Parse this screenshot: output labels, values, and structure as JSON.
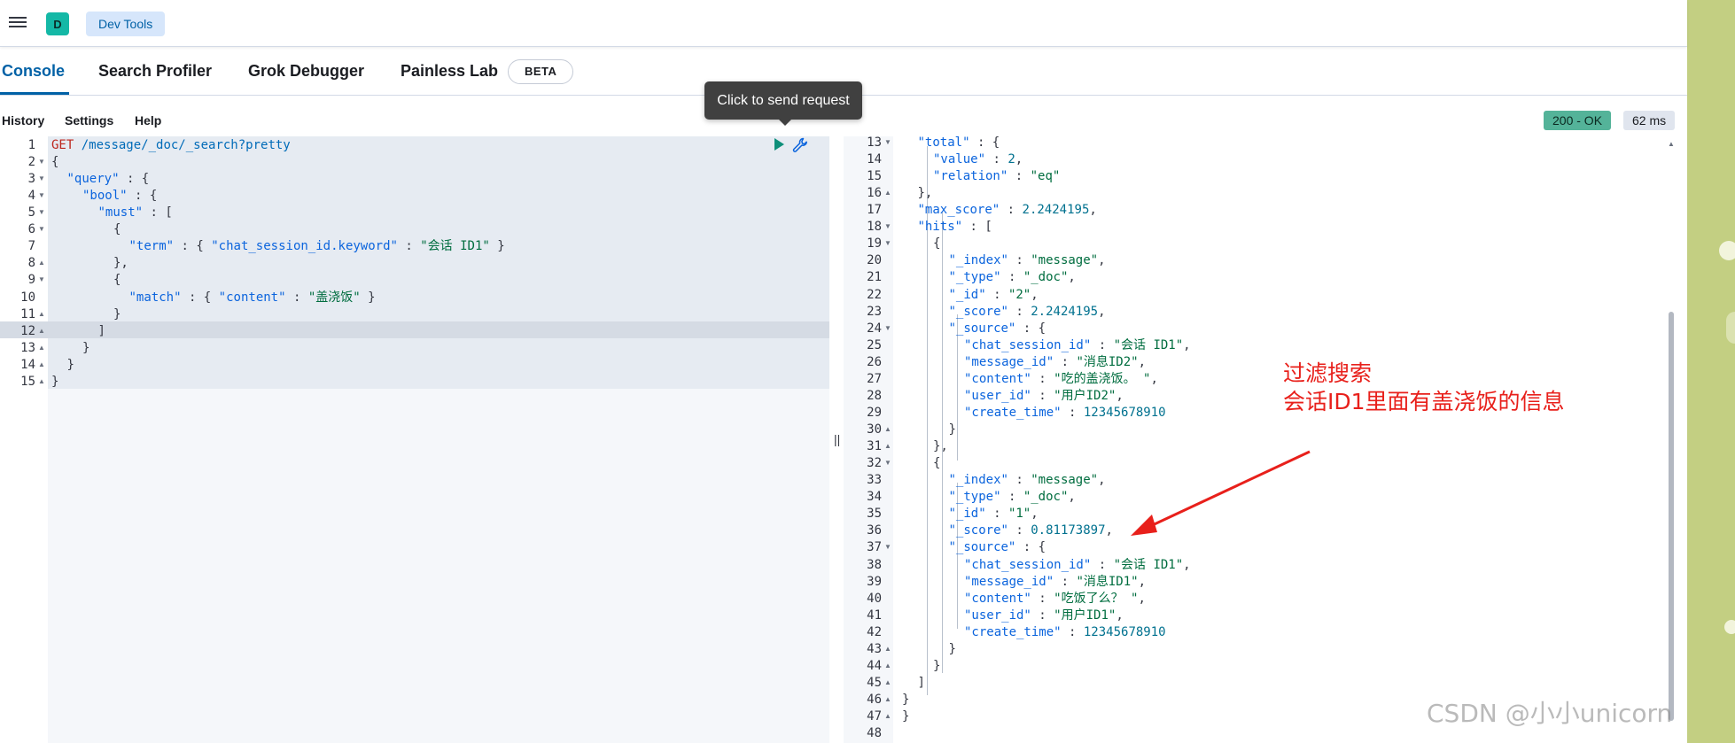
{
  "header": {
    "space_initial": "D",
    "breadcrumb": "Dev Tools"
  },
  "tabs": [
    {
      "label": "Console",
      "active": true
    },
    {
      "label": "Search Profiler",
      "active": false
    },
    {
      "label": "Grok Debugger",
      "active": false
    },
    {
      "label": "Painless Lab",
      "active": false
    }
  ],
  "beta_badge": "BETA",
  "tooltip": "Click to send request",
  "toolbar": {
    "history": "History",
    "settings": "Settings",
    "help": "Help"
  },
  "status": {
    "code": "200 - OK",
    "time": "62 ms"
  },
  "colors": {
    "accent": "#0061a6",
    "ok_badge": "#54b399",
    "annotation": "#e8201b"
  },
  "icons": [
    "menu-icon",
    "play-icon",
    "wrench-icon"
  ],
  "request": {
    "lines": [
      {
        "n": "1",
        "fold": "",
        "indent": 0,
        "tokens": [
          [
            "m",
            "GET"
          ],
          [
            "p",
            " "
          ],
          [
            "u",
            "/message/_doc/_search?pretty"
          ]
        ]
      },
      {
        "n": "2",
        "fold": "down",
        "indent": 0,
        "tokens": [
          [
            "p",
            "{"
          ]
        ]
      },
      {
        "n": "3",
        "fold": "down",
        "indent": 1,
        "tokens": [
          [
            "k",
            "\"query\""
          ],
          [
            "p",
            " : {"
          ]
        ]
      },
      {
        "n": "4",
        "fold": "down",
        "indent": 2,
        "tokens": [
          [
            "k",
            "\"bool\""
          ],
          [
            "p",
            " : {"
          ]
        ]
      },
      {
        "n": "5",
        "fold": "down",
        "indent": 3,
        "tokens": [
          [
            "k",
            "\"must\""
          ],
          [
            "p",
            " : ["
          ]
        ]
      },
      {
        "n": "6",
        "fold": "down",
        "indent": 4,
        "tokens": [
          [
            "p",
            "{"
          ]
        ]
      },
      {
        "n": "7",
        "fold": "",
        "indent": 5,
        "tokens": [
          [
            "k",
            "\"term\""
          ],
          [
            "p",
            " : { "
          ],
          [
            "k",
            "\"chat_session_id.keyword\""
          ],
          [
            "p",
            " : "
          ],
          [
            "s",
            "\"会话 ID1\""
          ],
          [
            "p",
            " }"
          ]
        ]
      },
      {
        "n": "8",
        "fold": "up",
        "indent": 4,
        "tokens": [
          [
            "p",
            "},"
          ]
        ]
      },
      {
        "n": "9",
        "fold": "down",
        "indent": 4,
        "tokens": [
          [
            "p",
            "{"
          ]
        ]
      },
      {
        "n": "10",
        "fold": "",
        "indent": 5,
        "tokens": [
          [
            "k",
            "\"match\""
          ],
          [
            "p",
            " : { "
          ],
          [
            "k",
            "\"content\""
          ],
          [
            "p",
            " : "
          ],
          [
            "s",
            "\"盖浇饭\""
          ],
          [
            "p",
            " }"
          ]
        ]
      },
      {
        "n": "11",
        "fold": "up",
        "indent": 4,
        "tokens": [
          [
            "p",
            "}"
          ]
        ]
      },
      {
        "n": "12",
        "fold": "up",
        "indent": 3,
        "tokens": [
          [
            "p",
            "]"
          ]
        ]
      },
      {
        "n": "13",
        "fold": "up",
        "indent": 2,
        "tokens": [
          [
            "p",
            "}"
          ]
        ]
      },
      {
        "n": "14",
        "fold": "up",
        "indent": 1,
        "tokens": [
          [
            "p",
            "}"
          ]
        ]
      },
      {
        "n": "15",
        "fold": "up",
        "indent": 0,
        "tokens": [
          [
            "p",
            "}"
          ]
        ]
      }
    ]
  },
  "response": {
    "lines": [
      {
        "n": "13",
        "fold": "down",
        "indent": 1,
        "tokens": [
          [
            "k",
            "\"total\""
          ],
          [
            "p",
            " : {"
          ]
        ]
      },
      {
        "n": "14",
        "fold": "",
        "indent": 2,
        "tokens": [
          [
            "k",
            "\"value\""
          ],
          [
            "p",
            " : "
          ],
          [
            "n",
            "2"
          ],
          [
            "p",
            ","
          ]
        ]
      },
      {
        "n": "15",
        "fold": "",
        "indent": 2,
        "tokens": [
          [
            "k",
            "\"relation\""
          ],
          [
            "p",
            " : "
          ],
          [
            "s",
            "\"eq\""
          ]
        ]
      },
      {
        "n": "16",
        "fold": "up",
        "indent": 1,
        "tokens": [
          [
            "p",
            "},"
          ]
        ]
      },
      {
        "n": "17",
        "fold": "",
        "indent": 1,
        "tokens": [
          [
            "k",
            "\"max_score\""
          ],
          [
            "p",
            " : "
          ],
          [
            "n",
            "2.2424195"
          ],
          [
            "p",
            ","
          ]
        ]
      },
      {
        "n": "18",
        "fold": "down",
        "indent": 1,
        "tokens": [
          [
            "k",
            "\"hits\""
          ],
          [
            "p",
            " : ["
          ]
        ]
      },
      {
        "n": "19",
        "fold": "down",
        "indent": 2,
        "tokens": [
          [
            "p",
            "{"
          ]
        ]
      },
      {
        "n": "20",
        "fold": "",
        "indent": 3,
        "tokens": [
          [
            "k",
            "\"_index\""
          ],
          [
            "p",
            " : "
          ],
          [
            "s",
            "\"message\""
          ],
          [
            "p",
            ","
          ]
        ]
      },
      {
        "n": "21",
        "fold": "",
        "indent": 3,
        "tokens": [
          [
            "k",
            "\"_type\""
          ],
          [
            "p",
            " : "
          ],
          [
            "s",
            "\"_doc\""
          ],
          [
            "p",
            ","
          ]
        ]
      },
      {
        "n": "22",
        "fold": "",
        "indent": 3,
        "tokens": [
          [
            "k",
            "\"_id\""
          ],
          [
            "p",
            " : "
          ],
          [
            "s",
            "\"2\""
          ],
          [
            "p",
            ","
          ]
        ]
      },
      {
        "n": "23",
        "fold": "",
        "indent": 3,
        "tokens": [
          [
            "k",
            "\"_score\""
          ],
          [
            "p",
            " : "
          ],
          [
            "n",
            "2.2424195"
          ],
          [
            "p",
            ","
          ]
        ]
      },
      {
        "n": "24",
        "fold": "down",
        "indent": 3,
        "tokens": [
          [
            "k",
            "\"_source\""
          ],
          [
            "p",
            " : {"
          ]
        ]
      },
      {
        "n": "25",
        "fold": "",
        "indent": 4,
        "tokens": [
          [
            "k",
            "\"chat_session_id\""
          ],
          [
            "p",
            " : "
          ],
          [
            "s",
            "\"会话 ID1\""
          ],
          [
            "p",
            ","
          ]
        ]
      },
      {
        "n": "26",
        "fold": "",
        "indent": 4,
        "tokens": [
          [
            "k",
            "\"message_id\""
          ],
          [
            "p",
            " : "
          ],
          [
            "s",
            "\"消息ID2\""
          ],
          [
            "p",
            ","
          ]
        ]
      },
      {
        "n": "27",
        "fold": "",
        "indent": 4,
        "tokens": [
          [
            "k",
            "\"content\""
          ],
          [
            "p",
            " : "
          ],
          [
            "s",
            "\"吃的盖浇饭。 \""
          ],
          [
            "p",
            ","
          ]
        ]
      },
      {
        "n": "28",
        "fold": "",
        "indent": 4,
        "tokens": [
          [
            "k",
            "\"user_id\""
          ],
          [
            "p",
            " : "
          ],
          [
            "s",
            "\"用户ID2\""
          ],
          [
            "p",
            ","
          ]
        ]
      },
      {
        "n": "29",
        "fold": "",
        "indent": 4,
        "tokens": [
          [
            "k",
            "\"create_time\""
          ],
          [
            "p",
            " : "
          ],
          [
            "n",
            "12345678910"
          ]
        ]
      },
      {
        "n": "30",
        "fold": "up",
        "indent": 3,
        "tokens": [
          [
            "p",
            "}"
          ]
        ]
      },
      {
        "n": "31",
        "fold": "up",
        "indent": 2,
        "tokens": [
          [
            "p",
            "},"
          ]
        ]
      },
      {
        "n": "32",
        "fold": "down",
        "indent": 2,
        "tokens": [
          [
            "p",
            "{"
          ]
        ]
      },
      {
        "n": "33",
        "fold": "",
        "indent": 3,
        "tokens": [
          [
            "k",
            "\"_index\""
          ],
          [
            "p",
            " : "
          ],
          [
            "s",
            "\"message\""
          ],
          [
            "p",
            ","
          ]
        ]
      },
      {
        "n": "34",
        "fold": "",
        "indent": 3,
        "tokens": [
          [
            "k",
            "\"_type\""
          ],
          [
            "p",
            " : "
          ],
          [
            "s",
            "\"_doc\""
          ],
          [
            "p",
            ","
          ]
        ]
      },
      {
        "n": "35",
        "fold": "",
        "indent": 3,
        "tokens": [
          [
            "k",
            "\"_id\""
          ],
          [
            "p",
            " : "
          ],
          [
            "s",
            "\"1\""
          ],
          [
            "p",
            ","
          ]
        ]
      },
      {
        "n": "36",
        "fold": "",
        "indent": 3,
        "tokens": [
          [
            "k",
            "\"_score\""
          ],
          [
            "p",
            " : "
          ],
          [
            "n",
            "0.81173897"
          ],
          [
            "p",
            ","
          ]
        ]
      },
      {
        "n": "37",
        "fold": "down",
        "indent": 3,
        "tokens": [
          [
            "k",
            "\"_source\""
          ],
          [
            "p",
            " : {"
          ]
        ]
      },
      {
        "n": "38",
        "fold": "",
        "indent": 4,
        "tokens": [
          [
            "k",
            "\"chat_session_id\""
          ],
          [
            "p",
            " : "
          ],
          [
            "s",
            "\"会话 ID1\""
          ],
          [
            "p",
            ","
          ]
        ]
      },
      {
        "n": "39",
        "fold": "",
        "indent": 4,
        "tokens": [
          [
            "k",
            "\"message_id\""
          ],
          [
            "p",
            " : "
          ],
          [
            "s",
            "\"消息ID1\""
          ],
          [
            "p",
            ","
          ]
        ]
      },
      {
        "n": "40",
        "fold": "",
        "indent": 4,
        "tokens": [
          [
            "k",
            "\"content\""
          ],
          [
            "p",
            " : "
          ],
          [
            "s",
            "\"吃饭了么？ \""
          ],
          [
            "p",
            ","
          ]
        ]
      },
      {
        "n": "41",
        "fold": "",
        "indent": 4,
        "tokens": [
          [
            "k",
            "\"user_id\""
          ],
          [
            "p",
            " : "
          ],
          [
            "s",
            "\"用户ID1\""
          ],
          [
            "p",
            ","
          ]
        ]
      },
      {
        "n": "42",
        "fold": "",
        "indent": 4,
        "tokens": [
          [
            "k",
            "\"create_time\""
          ],
          [
            "p",
            " : "
          ],
          [
            "n",
            "12345678910"
          ]
        ]
      },
      {
        "n": "43",
        "fold": "up",
        "indent": 3,
        "tokens": [
          [
            "p",
            "}"
          ]
        ]
      },
      {
        "n": "44",
        "fold": "up",
        "indent": 2,
        "tokens": [
          [
            "p",
            "}"
          ]
        ]
      },
      {
        "n": "45",
        "fold": "up",
        "indent": 1,
        "tokens": [
          [
            "p",
            "]"
          ]
        ]
      },
      {
        "n": "46",
        "fold": "up",
        "indent": 0,
        "tokens": [
          [
            "p",
            "}"
          ]
        ]
      },
      {
        "n": "47",
        "fold": "up",
        "indent": -1,
        "tokens": [
          [
            "p",
            "}"
          ]
        ]
      },
      {
        "n": "48",
        "fold": "",
        "indent": -1,
        "tokens": []
      }
    ]
  },
  "annotation": {
    "line1": "过滤搜索",
    "line2": "会话ID1里面有盖浇饭的信息"
  },
  "watermark": "CSDN @小小unicorn"
}
